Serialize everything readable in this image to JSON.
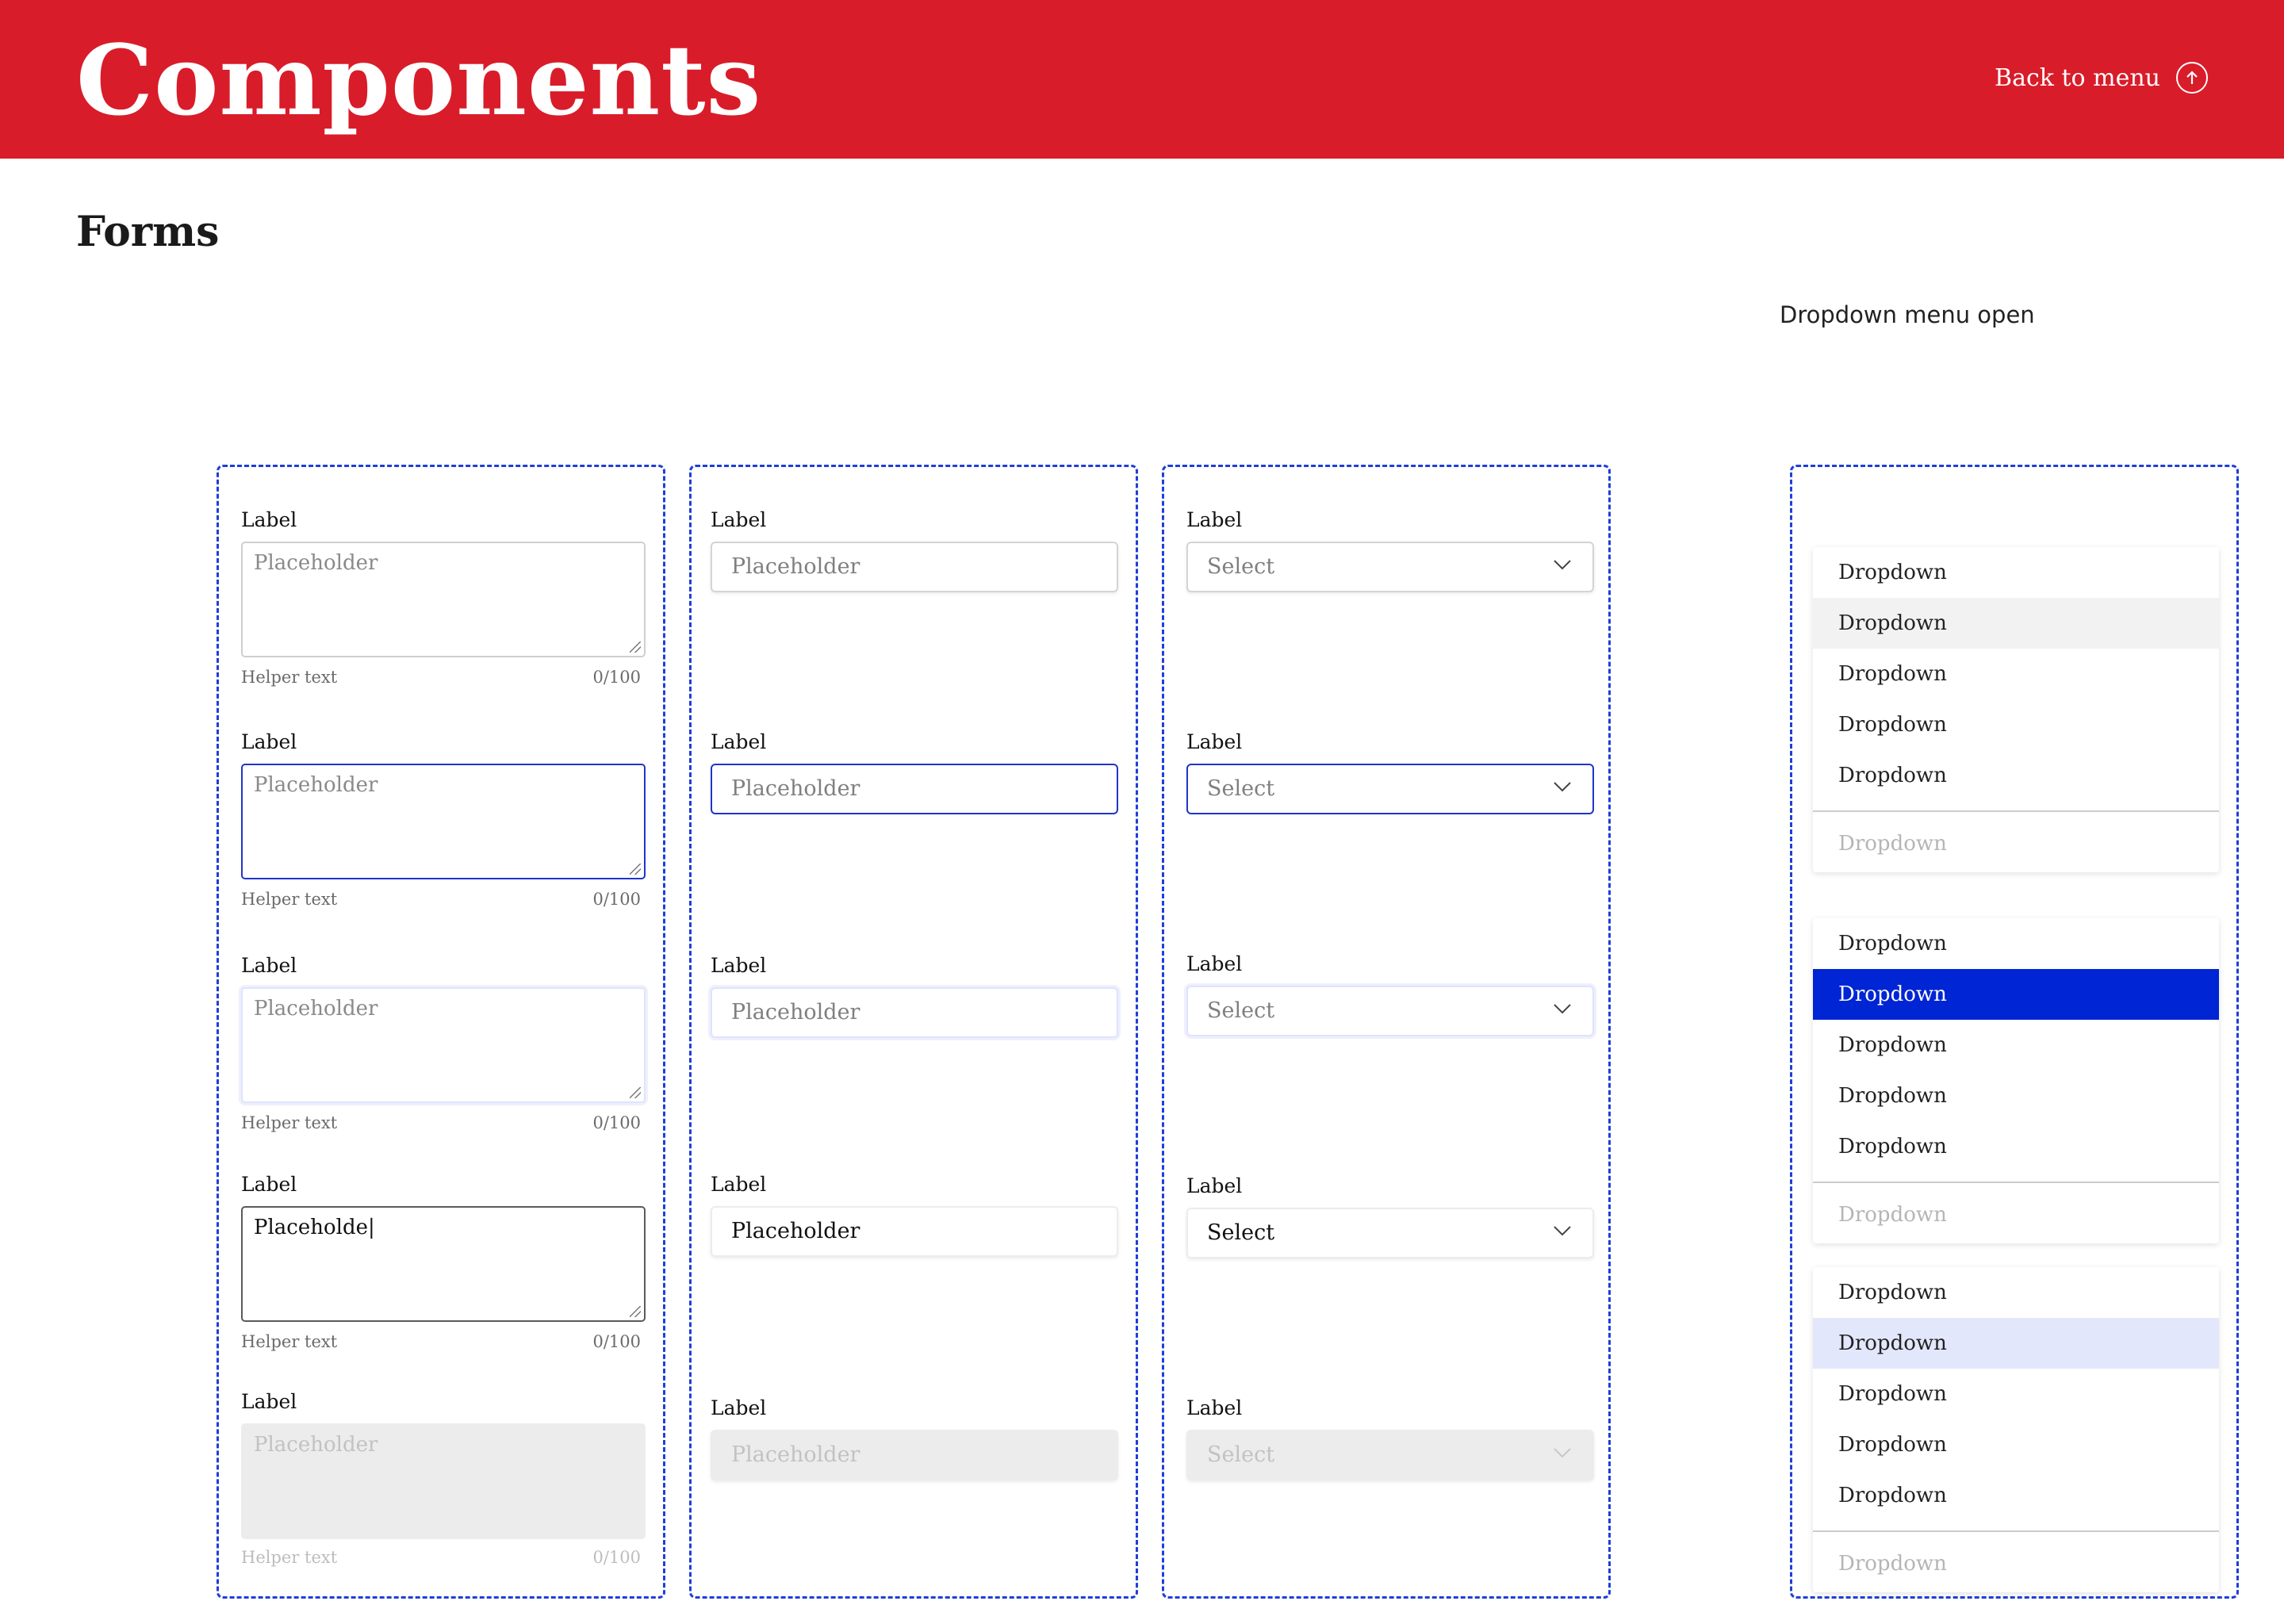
{
  "header": {
    "title": "Components",
    "back_label": "Back to menu"
  },
  "section_title": "Forms",
  "dropdown_caption": "Dropdown menu open",
  "textareas": [
    {
      "label": "Label",
      "text": "Placeholder",
      "helper": "Helper text",
      "counter": "0/100",
      "state": "default"
    },
    {
      "label": "Label",
      "text": "Placeholder",
      "helper": "Helper text",
      "counter": "0/100",
      "state": "focus"
    },
    {
      "label": "Label",
      "text": "Placeholder",
      "helper": "Helper text",
      "counter": "0/100",
      "state": "hover"
    },
    {
      "label": "Label",
      "text": "Placeholde|",
      "helper": "Helper text",
      "counter": "0/100",
      "state": "filled"
    },
    {
      "label": "Label",
      "text": "Placeholder",
      "helper": "Helper text",
      "counter": "0/100",
      "state": "disabled"
    }
  ],
  "inputs": [
    {
      "label": "Label",
      "text": "Placeholder",
      "state": "default"
    },
    {
      "label": "Label",
      "text": "Placeholder",
      "state": "focus"
    },
    {
      "label": "Label",
      "text": "Placeholder",
      "state": "hover"
    },
    {
      "label": "Label",
      "text": "Placeholder",
      "state": "filled"
    },
    {
      "label": "Label",
      "text": "Placeholder",
      "state": "disabled"
    }
  ],
  "selects": [
    {
      "label": "Label",
      "text": "Select",
      "state": "default"
    },
    {
      "label": "Label",
      "text": "Select",
      "state": "focus"
    },
    {
      "label": "Label",
      "text": "Select",
      "state": "hover"
    },
    {
      "label": "Label",
      "text": "Select",
      "state": "filled"
    },
    {
      "label": "Label",
      "text": "Select",
      "state": "disabled"
    }
  ],
  "menus": [
    {
      "items": [
        "Dropdown",
        "Dropdown",
        "Dropdown",
        "Dropdown",
        "Dropdown"
      ],
      "selected_index": 1,
      "selected_style": "grey",
      "disabled_item": "Dropdown"
    },
    {
      "items": [
        "Dropdown",
        "Dropdown",
        "Dropdown",
        "Dropdown",
        "Dropdown"
      ],
      "selected_index": 1,
      "selected_style": "blue",
      "disabled_item": "Dropdown"
    },
    {
      "items": [
        "Dropdown",
        "Dropdown",
        "Dropdown",
        "Dropdown",
        "Dropdown"
      ],
      "selected_index": 1,
      "selected_style": "light",
      "disabled_item": "Dropdown"
    }
  ],
  "colors": {
    "brand_red": "#d91c29",
    "focus_blue": "#1f35c8",
    "selected_blue": "#0025d4",
    "dashed_border": "#1f3fd6"
  }
}
